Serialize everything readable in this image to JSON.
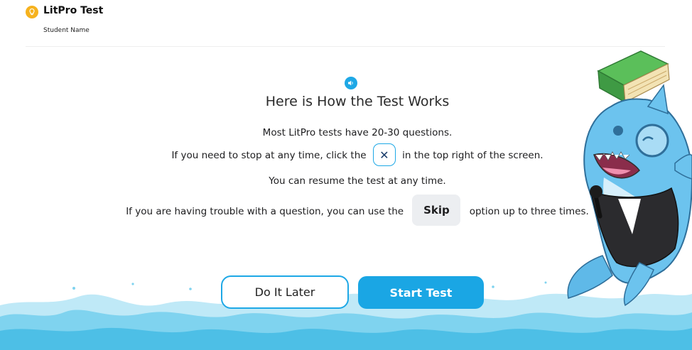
{
  "header": {
    "app_title": "LitPro Test",
    "student_label": "Student Name",
    "logo_icon": "lightbulb-icon"
  },
  "intro": {
    "audio_icon": "speaker-icon",
    "heading": "Here is How the Test Works",
    "line1": "Most LitPro tests have 20-30 questions.",
    "line2_before": "If you need to stop at any time, click the",
    "close_symbol": "✕",
    "line2_after": "in the top right of the screen.",
    "line3": "You can resume the test at any time.",
    "line4_before": "If you are having trouble with a question, you can use the",
    "skip_label": "Skip",
    "line4_after": "option up to three times."
  },
  "actions": {
    "do_it_later": "Do It Later",
    "start_test": "Start Test"
  },
  "colors": {
    "accent": "#1ea8e6",
    "button_primary": "#1aa6e4",
    "logo": "#f6b21e",
    "wave_light": "#bfe9f7",
    "wave_mid": "#7fd3ef",
    "wave_deep": "#4dbfe6"
  }
}
